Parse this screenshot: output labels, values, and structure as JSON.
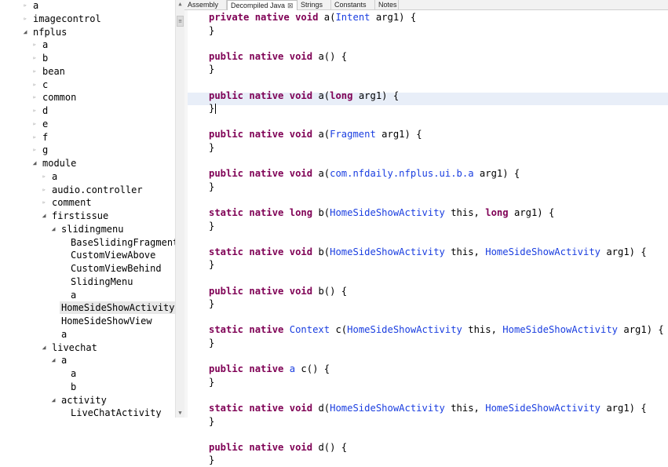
{
  "tabs": [
    {
      "label": "Assembly",
      "active": false
    },
    {
      "label": "Decompiled Java",
      "active": true,
      "close": "⊠"
    },
    {
      "label": "Strings",
      "active": false
    },
    {
      "label": "Constants",
      "active": false
    },
    {
      "label": "Notes",
      "active": false
    }
  ],
  "tree": [
    {
      "label": "a",
      "depth": 0,
      "state": "closed"
    },
    {
      "label": "imagecontrol",
      "depth": 0,
      "state": "closed"
    },
    {
      "label": "nfplus",
      "depth": 0,
      "state": "open"
    },
    {
      "label": "a",
      "depth": 1,
      "state": "closed"
    },
    {
      "label": "b",
      "depth": 1,
      "state": "closed"
    },
    {
      "label": "bean",
      "depth": 1,
      "state": "closed"
    },
    {
      "label": "c",
      "depth": 1,
      "state": "closed"
    },
    {
      "label": "common",
      "depth": 1,
      "state": "closed"
    },
    {
      "label": "d",
      "depth": 1,
      "state": "closed"
    },
    {
      "label": "e",
      "depth": 1,
      "state": "closed"
    },
    {
      "label": "f",
      "depth": 1,
      "state": "closed"
    },
    {
      "label": "g",
      "depth": 1,
      "state": "closed"
    },
    {
      "label": "module",
      "depth": 1,
      "state": "open"
    },
    {
      "label": "a",
      "depth": 2,
      "state": "closed"
    },
    {
      "label": "audio.controller",
      "depth": 2,
      "state": "closed"
    },
    {
      "label": "comment",
      "depth": 2,
      "state": "closed"
    },
    {
      "label": "firstissue",
      "depth": 2,
      "state": "open"
    },
    {
      "label": "slidingmenu",
      "depth": 3,
      "state": "open"
    },
    {
      "label": "BaseSlidingFragment",
      "depth": 4,
      "state": "leaf"
    },
    {
      "label": "CustomViewAbove",
      "depth": 4,
      "state": "leaf"
    },
    {
      "label": "CustomViewBehind",
      "depth": 4,
      "state": "leaf"
    },
    {
      "label": "SlidingMenu",
      "depth": 4,
      "state": "leaf"
    },
    {
      "label": "a",
      "depth": 4,
      "state": "leaf"
    },
    {
      "label": "HomeSideShowActivity",
      "depth": 3,
      "state": "leaf",
      "selected": true
    },
    {
      "label": "HomeSideShowView",
      "depth": 3,
      "state": "leaf"
    },
    {
      "label": "a",
      "depth": 3,
      "state": "leaf"
    },
    {
      "label": "livechat",
      "depth": 2,
      "state": "open"
    },
    {
      "label": "a",
      "depth": 3,
      "state": "open"
    },
    {
      "label": "a",
      "depth": 4,
      "state": "leaf"
    },
    {
      "label": "b",
      "depth": 4,
      "state": "leaf"
    },
    {
      "label": "activity",
      "depth": 3,
      "state": "open"
    },
    {
      "label": "LiveChatActivity",
      "depth": 4,
      "state": "leaf"
    }
  ],
  "code": [
    [
      [
        "kw",
        "private"
      ],
      [
        "plain",
        " "
      ],
      [
        "kw",
        "native"
      ],
      [
        "plain",
        " "
      ],
      [
        "kw",
        "void"
      ],
      [
        "plain",
        " a("
      ],
      [
        "ty",
        "Intent"
      ],
      [
        "plain",
        " arg1) {"
      ]
    ],
    [
      [
        "plain",
        "}"
      ]
    ],
    [],
    [
      [
        "kw",
        "public"
      ],
      [
        "plain",
        " "
      ],
      [
        "kw",
        "native"
      ],
      [
        "plain",
        " "
      ],
      [
        "kw",
        "void"
      ],
      [
        "plain",
        " a() {"
      ]
    ],
    [
      [
        "plain",
        "}"
      ]
    ],
    [],
    [
      [
        "kw",
        "public"
      ],
      [
        "plain",
        " "
      ],
      [
        "kw",
        "native"
      ],
      [
        "plain",
        " "
      ],
      [
        "kw",
        "void"
      ],
      [
        "plain",
        " a("
      ],
      [
        "kw",
        "long"
      ],
      [
        "plain",
        " arg1) {"
      ]
    ],
    [
      [
        "plain",
        "}"
      ]
    ],
    [],
    [
      [
        "kw",
        "public"
      ],
      [
        "plain",
        " "
      ],
      [
        "kw",
        "native"
      ],
      [
        "plain",
        " "
      ],
      [
        "kw",
        "void"
      ],
      [
        "plain",
        " a("
      ],
      [
        "ty",
        "Fragment"
      ],
      [
        "plain",
        " arg1) {"
      ]
    ],
    [
      [
        "plain",
        "}"
      ]
    ],
    [],
    [
      [
        "kw",
        "public"
      ],
      [
        "plain",
        " "
      ],
      [
        "kw",
        "native"
      ],
      [
        "plain",
        " "
      ],
      [
        "kw",
        "void"
      ],
      [
        "plain",
        " a("
      ],
      [
        "ty",
        "com.nfdaily.nfplus.ui.b.a"
      ],
      [
        "plain",
        " arg1) {"
      ]
    ],
    [
      [
        "plain",
        "}"
      ]
    ],
    [],
    [
      [
        "kw",
        "static"
      ],
      [
        "plain",
        " "
      ],
      [
        "kw",
        "native"
      ],
      [
        "plain",
        " "
      ],
      [
        "kw",
        "long"
      ],
      [
        "plain",
        " b("
      ],
      [
        "ty",
        "HomeSideShowActivity"
      ],
      [
        "plain",
        " this, "
      ],
      [
        "kw",
        "long"
      ],
      [
        "plain",
        " arg1) {"
      ]
    ],
    [
      [
        "plain",
        "}"
      ]
    ],
    [],
    [
      [
        "kw",
        "static"
      ],
      [
        "plain",
        " "
      ],
      [
        "kw",
        "native"
      ],
      [
        "plain",
        " "
      ],
      [
        "kw",
        "void"
      ],
      [
        "plain",
        " b("
      ],
      [
        "ty",
        "HomeSideShowActivity"
      ],
      [
        "plain",
        " this, "
      ],
      [
        "ty",
        "HomeSideShowActivity"
      ],
      [
        "plain",
        " arg1) {"
      ]
    ],
    [
      [
        "plain",
        "}"
      ]
    ],
    [],
    [
      [
        "kw",
        "public"
      ],
      [
        "plain",
        " "
      ],
      [
        "kw",
        "native"
      ],
      [
        "plain",
        " "
      ],
      [
        "kw",
        "void"
      ],
      [
        "plain",
        " b() {"
      ]
    ],
    [
      [
        "plain",
        "}"
      ]
    ],
    [],
    [
      [
        "kw",
        "static"
      ],
      [
        "plain",
        " "
      ],
      [
        "kw",
        "native"
      ],
      [
        "plain",
        " "
      ],
      [
        "ty",
        "Context"
      ],
      [
        "plain",
        " c("
      ],
      [
        "ty",
        "HomeSideShowActivity"
      ],
      [
        "plain",
        " this, "
      ],
      [
        "ty",
        "HomeSideShowActivity"
      ],
      [
        "plain",
        " arg1) {"
      ]
    ],
    [
      [
        "plain",
        "}"
      ]
    ],
    [],
    [
      [
        "kw",
        "public"
      ],
      [
        "plain",
        " "
      ],
      [
        "kw",
        "native"
      ],
      [
        "plain",
        " "
      ],
      [
        "ty",
        "a"
      ],
      [
        "plain",
        " c() {"
      ]
    ],
    [
      [
        "plain",
        "}"
      ]
    ],
    [],
    [
      [
        "kw",
        "static"
      ],
      [
        "plain",
        " "
      ],
      [
        "kw",
        "native"
      ],
      [
        "plain",
        " "
      ],
      [
        "kw",
        "void"
      ],
      [
        "plain",
        " d("
      ],
      [
        "ty",
        "HomeSideShowActivity"
      ],
      [
        "plain",
        " this, "
      ],
      [
        "ty",
        "HomeSideShowActivity"
      ],
      [
        "plain",
        " arg1) {"
      ]
    ],
    [
      [
        "plain",
        "}"
      ]
    ],
    [],
    [
      [
        "kw",
        "public"
      ],
      [
        "plain",
        " "
      ],
      [
        "kw",
        "native"
      ],
      [
        "plain",
        " "
      ],
      [
        "kw",
        "void"
      ],
      [
        "plain",
        " d() {"
      ]
    ],
    [
      [
        "plain",
        "}"
      ]
    ]
  ],
  "caret_line": 7,
  "icons": {
    "tree_collapsed": "▹",
    "tree_expanded": "◢",
    "scroll_up": "▲",
    "scroll_down": "▼",
    "scroll_thumb": "≡"
  },
  "colors": {
    "keyword": "#7f0055",
    "type": "#1a3ee0",
    "current_line": "#e8eef8"
  }
}
